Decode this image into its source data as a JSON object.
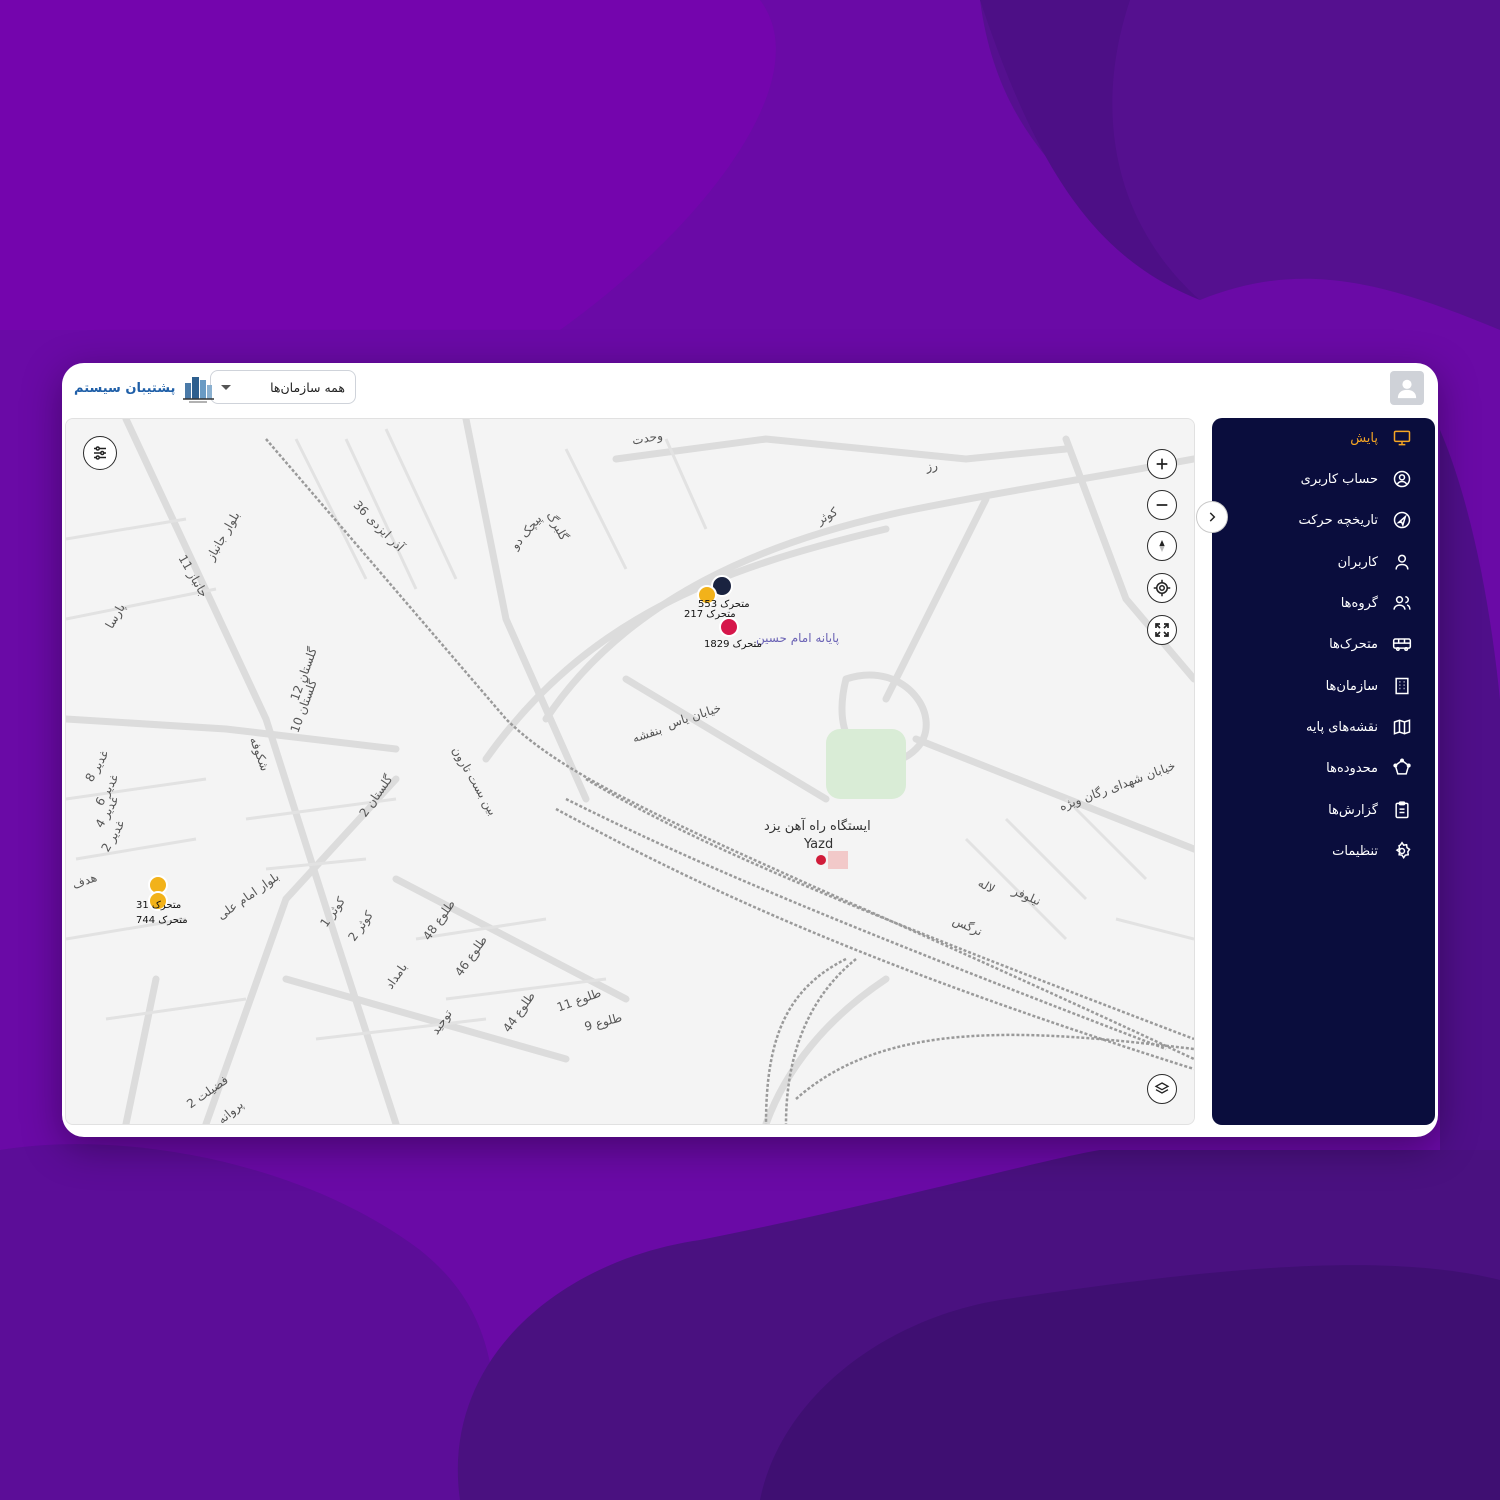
{
  "header": {
    "brand_name": "پشتیبان سیستم",
    "org_select": {
      "value": "همه سازمان‌ها"
    }
  },
  "sidebar": {
    "items": [
      {
        "label": "پایش",
        "icon": "monitor-icon",
        "active": true
      },
      {
        "label": "حساب کاربری",
        "icon": "user-circle-icon",
        "active": false
      },
      {
        "label": "تاریخچه حرکت",
        "icon": "navigation-icon",
        "active": false
      },
      {
        "label": "کاربران",
        "icon": "user-icon",
        "active": false
      },
      {
        "label": "گروه‌ها",
        "icon": "users-icon",
        "active": false
      },
      {
        "label": "متحرک‌ها",
        "icon": "bus-icon",
        "active": false
      },
      {
        "label": "سازمان‌ها",
        "icon": "building-icon",
        "active": false
      },
      {
        "label": "نقشه‌های پایه",
        "icon": "map-icon",
        "active": false
      },
      {
        "label": "محدوده‌ها",
        "icon": "polygon-icon",
        "active": false
      },
      {
        "label": "گزارش‌ها",
        "icon": "clipboard-icon",
        "active": false
      },
      {
        "label": "تنظیمات",
        "icon": "settings-icon",
        "active": false
      }
    ]
  },
  "map": {
    "station_label": "ایستگاه راه آهن یزد",
    "station_label_en": "Yazd",
    "terminal_label": "پایانه امام حسین",
    "vehicles": [
      {
        "label": "متحرک 553",
        "color": "#1a2340"
      },
      {
        "label": "متحرک 217",
        "color": "#f2b21a"
      },
      {
        "label": "متحرک 1829",
        "color": "#d6174b"
      },
      {
        "label": "متحرک 31",
        "color": "#f2b21a"
      },
      {
        "label": "متحرک 744",
        "color": "#f2b21a"
      }
    ],
    "streets": [
      "خیابان یاس",
      "بنفشه",
      "خیابان شهدای رگان ویژه",
      "نیلوفر",
      "لاله",
      "نرگس",
      "گلستان 12",
      "گلستان 10",
      "گلستان 2",
      "شکوفه",
      "بلوار جانباز",
      "جانباز 11",
      "پارسا",
      "غدیر 8",
      "غدیر 6",
      "غدیر 4",
      "غدیر 2",
      "هدف",
      "بین بست تارون",
      "گلبرگ",
      "پیچک دو",
      "آذر ایزدی 36",
      "کوثر",
      "کوثر 1",
      "کوثر 2",
      "طلوع 48",
      "طلوع 44",
      "طلوع 46",
      "طلوع 11",
      "طلوع 9",
      "بامداد",
      "توحید",
      "بلوار امام علی",
      "فضیلت 2",
      "پروانه",
      "وحدت",
      "رز"
    ]
  },
  "colors": {
    "accent": "#f5a524",
    "sidebar_bg": "#0a0d3d",
    "brand": "#1f5fa8"
  }
}
